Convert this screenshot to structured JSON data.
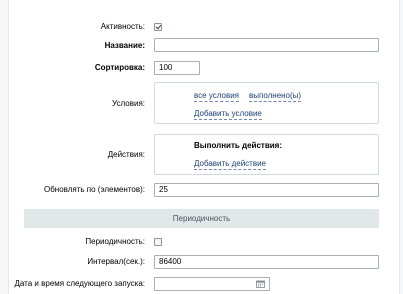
{
  "form": {
    "active_label": "Активность:",
    "active_checked": true,
    "name_label": "Название:",
    "name_value": "",
    "sort_label": "Сортировка:",
    "sort_value": "100",
    "conditions_label": "Условия:",
    "conditions": {
      "all_conditions": "все условия",
      "fulfilled": "выполнено(ы)",
      "add_condition": "Добавить условие"
    },
    "actions_label": "Действия:",
    "actions": {
      "title": "Выполнить действия:",
      "add_action": "Добавить действие"
    },
    "refresh_label": "Обновлять по (элементов):",
    "refresh_value": "25"
  },
  "periodicity_section": {
    "header": "Периодичность",
    "periodicity_label": "Периодичность:",
    "periodicity_checked": false,
    "interval_label": "Интервал(сек.):",
    "interval_value": "86400",
    "next_run_label": "Дата и время следующего запуска:",
    "next_run_value": ""
  },
  "icons": {
    "active_checkbox": "checkmark-icon",
    "next_run_picker": "calendar-icon"
  }
}
